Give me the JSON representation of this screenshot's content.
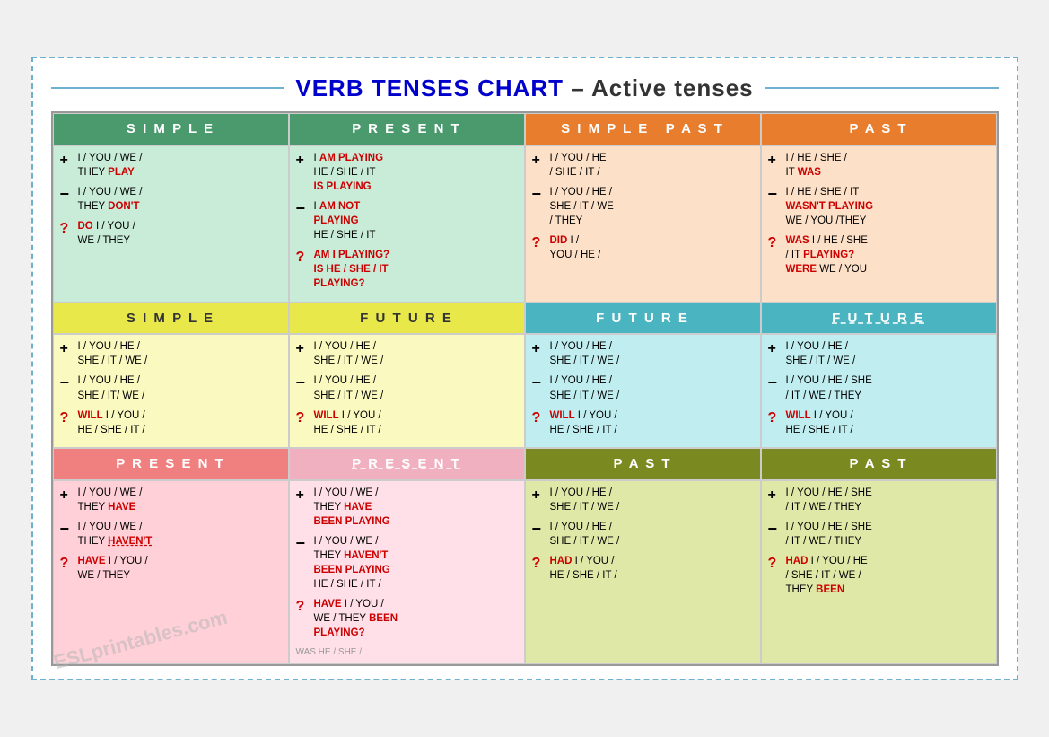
{
  "title": {
    "main": "VERB TENSES CHART",
    "sub": " – Active tenses"
  },
  "sections": {
    "row1_headers": [
      "SIMPLE",
      "PRESENT",
      "SIMPLE PAST",
      "PAST"
    ],
    "row2_headers": [
      "SIMPLE",
      "FUTURE",
      "FUTURE",
      "FUTURE"
    ],
    "row3_headers": [
      "PRESENT",
      "PRESENT",
      "PAST",
      "PAST"
    ]
  },
  "cells": {
    "r1c1_plus": "I / YOU / WE / THEY",
    "r1c1_plus_verb": "PLAY",
    "r1c1_minus": "I / YOU / WE / THEY",
    "r1c1_minus_verb": "DON'T",
    "r1c1_q": "I / YOU / WE / THEY",
    "r1c1_q_verb": "DO",
    "r1c2_plus_pre": "I",
    "r1c2_plus_verb1": "AM PLAYING",
    "r1c2_plus_mid": "HE / SHE / IT",
    "r1c2_plus_verb2": "IS PLAYING",
    "r1c2_minus_pre": "I",
    "r1c2_minus_verb": "AM NOT",
    "r1c2_minus_mid": "PLAYING\nHE / SHE / IT",
    "r1c2_q_verb": "AM I PLAYING?",
    "r1c2_q_mid": "IS HE / SHE / IT PLAYING?",
    "r1c3_plus": "I / YOU / HE / SHE / IT /",
    "r1c3_minus": "I / YOU / HE / SHE / IT / WE / THEY",
    "r1c3_q_verb": "DID",
    "r1c3_q_mid": "I / YOU / HE /",
    "r1c4_plus": "I / HE / SHE / IT",
    "r1c4_plus_verb": "WAS",
    "r1c4_minus": "I / HE / SHE / IT",
    "r1c4_minus_verb": "WASN'T PLAYING",
    "r1c4_minus_end": "WE / YOU /THEY",
    "r1c4_q_verb": "WAS",
    "r1c4_q_mid": "I / HE / SHE / IT",
    "r1c4_q_verb2": "PLAYING?",
    "r1c4_q_end_verb": "WERE",
    "r1c4_q_end": "WE / YOU"
  }
}
